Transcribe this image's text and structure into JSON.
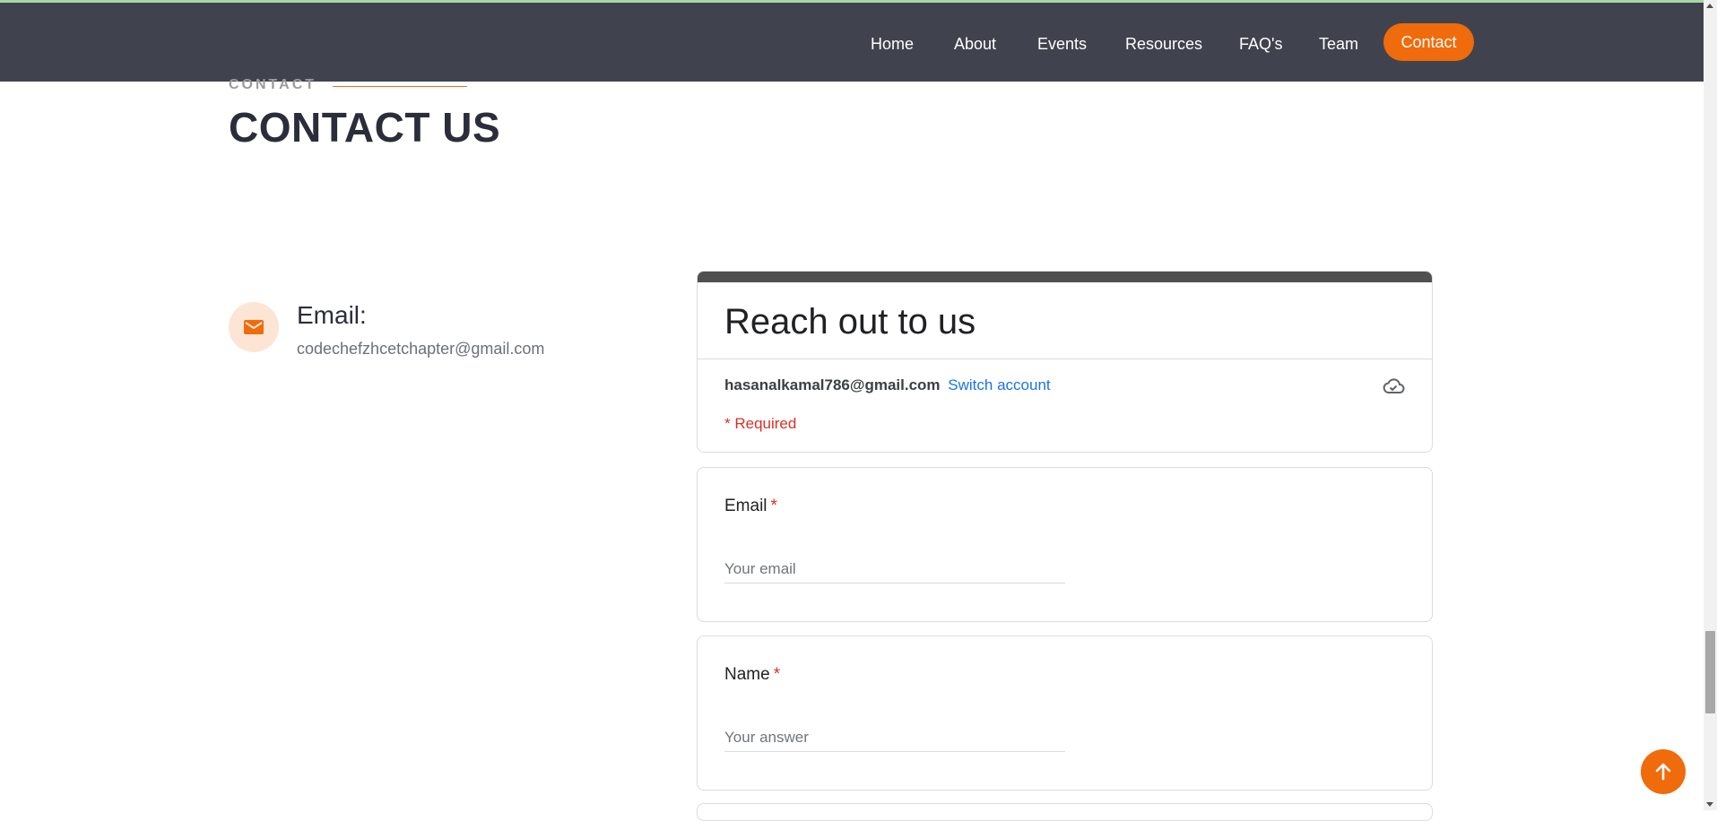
{
  "nav": {
    "items": [
      "Home",
      "About",
      "Events",
      "Resources",
      "FAQ's",
      "Team"
    ],
    "contact_label": "Contact"
  },
  "section": {
    "subtitle": "CONTACT",
    "title": "CONTACT US"
  },
  "contact_info": {
    "icon": "mail-icon",
    "label": "Email:",
    "value": "codechefzhcetchapter@gmail.com"
  },
  "form": {
    "title": "Reach out to us",
    "account_email": "hasanalkamal786@gmail.com",
    "switch_account": "Switch account",
    "save_icon": "cloud-check-icon",
    "required_note": "* Required",
    "questions": [
      {
        "label": "Email",
        "required_mark": "*",
        "placeholder": "Your email"
      },
      {
        "label": "Name",
        "required_mark": "*",
        "placeholder": "Your answer"
      }
    ]
  },
  "back_to_top_icon": "arrow-up-icon",
  "colors": {
    "header_bg": "#40434e",
    "accent": "#f06b0b",
    "title_dark": "#2b2d3b",
    "link_blue": "#1a73e8",
    "required_red": "#d93025"
  }
}
